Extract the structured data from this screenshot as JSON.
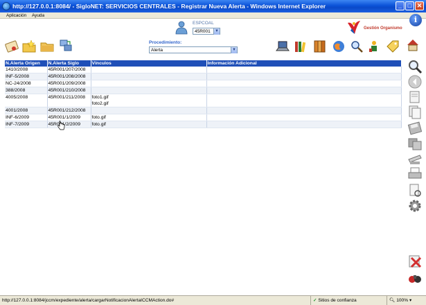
{
  "window": {
    "title": "http://127.0.0.1:8084/ - SigloNET: SERVICIOS CENTRALES - Registrar Nueva Alerta - Windows Internet Explorer",
    "minimize": "_",
    "maximize": "□",
    "close": "✕"
  },
  "menu": {
    "items": [
      "Aplicación",
      "Ayuda"
    ]
  },
  "header": {
    "espc_label": "ESPCOAL",
    "espc_selected": "45R001",
    "org_label": "Gestión Organismo",
    "info_glyph": "i",
    "procedimiento_label": "Procedimiento:",
    "procedimiento_selected": "Alerta"
  },
  "table": {
    "headers": [
      "N.Alerta Origen",
      "N.Alerta Siglo",
      "Vínculos",
      "Información Adicional"
    ],
    "rows": [
      [
        "1410/2008",
        "45R001/207/2008",
        "",
        ""
      ],
      [
        "INF-5/2008",
        "45R001/208/2008",
        "",
        ""
      ],
      [
        "NC-24/2008",
        "45R001/209/2008",
        "",
        ""
      ],
      [
        "388/2008",
        "45R001/210/2008",
        "",
        ""
      ],
      [
        "4005/2008",
        "45R001/211/2008",
        "foto1.gif\nfoto2.gif",
        ""
      ],
      [
        "4001/2008",
        "45R001/212/2008",
        "",
        ""
      ],
      [
        "INF-6/2009",
        "45R001/1/2009",
        "foto.gif",
        ""
      ],
      [
        "INF-7/2009",
        "45R001/2/2009",
        "foto.gif",
        ""
      ]
    ]
  },
  "status": {
    "url": "http://127.0.0.1:8084/jccm/expediente/alerta/cargarNotificacionAlertaICCMAction.do#",
    "zone": "Sitios de confianza",
    "zoom": "100%"
  },
  "icons": {
    "toolbar_left": [
      "certificate-icon",
      "folder-star-icon",
      "folder-icon",
      "computer-transfer-icon"
    ],
    "toolbar_right": [
      "laptop-icon",
      "books-icon",
      "binders-icon",
      "globe-icon",
      "search-tools-icon",
      "user-network-icon",
      "tag-icon",
      "house-icon"
    ],
    "sidebar": [
      "magnifier-icon",
      "back-circle-icon",
      "document-icon",
      "documents-icon",
      "floppy-icon",
      "floppy-copy-icon",
      "scanner-icon",
      "printer-icon",
      "print-preview-icon",
      "gear-icon",
      "cancel-icon",
      "exit-icon"
    ]
  }
}
